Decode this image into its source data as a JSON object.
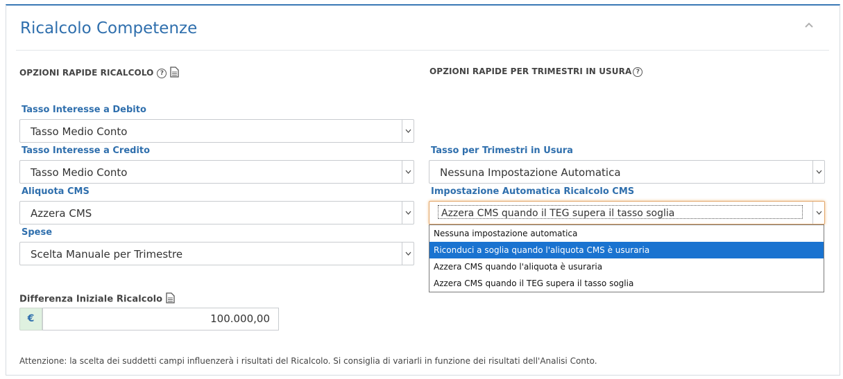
{
  "header": {
    "title": "Ricalcolo Competenze"
  },
  "sections": {
    "left": {
      "title": "OPZIONI RAPIDE RICALCOLO"
    },
    "right": {
      "title": "OPZIONI RAPIDE PER TRIMESTRI IN USURA"
    }
  },
  "fields": {
    "tasso_debito": {
      "label": "Tasso Interesse a Debito",
      "value": "Tasso Medio Conto"
    },
    "tasso_credito": {
      "label": "Tasso Interesse a Credito",
      "value": "Tasso Medio Conto"
    },
    "aliquota_cms": {
      "label": "Aliquota CMS",
      "value": "Azzera CMS"
    },
    "spese": {
      "label": "Spese",
      "value": "Scelta Manuale per Trimestre"
    },
    "tasso_usura": {
      "label": "Tasso per Trimestri in Usura",
      "value": "Nessuna Impostazione Automatica"
    },
    "ricalcolo_cms": {
      "label": "Impostazione Automatica Ricalcolo CMS",
      "value": "Azzera CMS quando il TEG supera il tasso soglia",
      "options": [
        "Nessuna impostazione automatica",
        "Riconduci a soglia quando l'aliquota CMS è usuraria",
        "Azzera CMS quando l'aliquota è usuraria",
        "Azzera CMS quando il TEG supera il tasso soglia"
      ]
    },
    "differenza": {
      "label": "Differenza Iniziale Ricalcolo",
      "currency": "€",
      "value": "100.000,00"
    }
  },
  "note": "Attenzione: la scelta dei suddetti campi influenzerà i risultati del Ricalcolo. Si consiglia di variarli in funzione dei risultati dell'Analisi Conto.",
  "icons": [
    "question-icon",
    "document-icon",
    "chevron-down-icon",
    "chevron-up-icon"
  ],
  "colors": {
    "accent": "#2f6fad",
    "selected": "#1a73d0",
    "currency_bg": "#dff1e0"
  }
}
